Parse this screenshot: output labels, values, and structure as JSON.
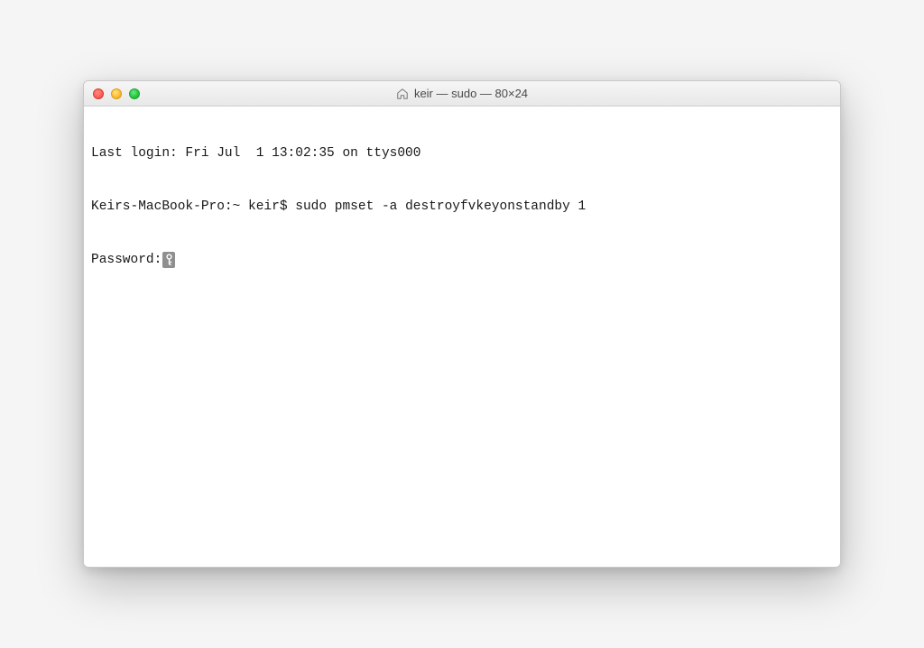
{
  "window": {
    "title": "keir — sudo — 80×24"
  },
  "terminal": {
    "last_login": "Last login: Fri Jul  1 13:02:35 on ttys000",
    "prompt": "Keirs-MacBook-Pro:~ keir$ ",
    "command": "sudo pmset -a destroyfvkeyonstandby 1",
    "password_label": "Password:"
  }
}
